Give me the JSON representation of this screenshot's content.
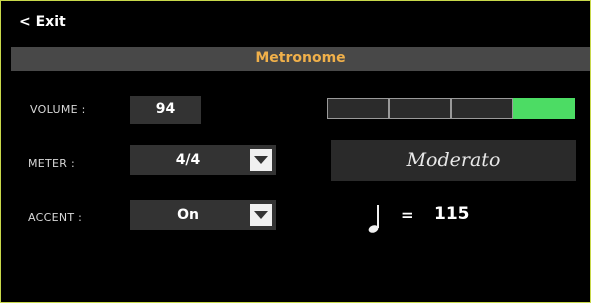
{
  "header": {
    "exit_label": "< Exit",
    "title": "Metronome"
  },
  "volume": {
    "label": "VOLUME :",
    "value": "94",
    "level_segments_total": 4,
    "level_segments_lit": 1
  },
  "meter": {
    "label": "METER :",
    "value": "4/4"
  },
  "accent": {
    "label": "ACCENT :",
    "value": "On"
  },
  "tempo": {
    "name": "Moderato",
    "equals": "=",
    "bpm": "115",
    "note_icon": "quarter-note-icon"
  },
  "colors": {
    "frame": "#c8d84a",
    "title_text": "#f0b04a",
    "level_on": "#4cdc64"
  }
}
